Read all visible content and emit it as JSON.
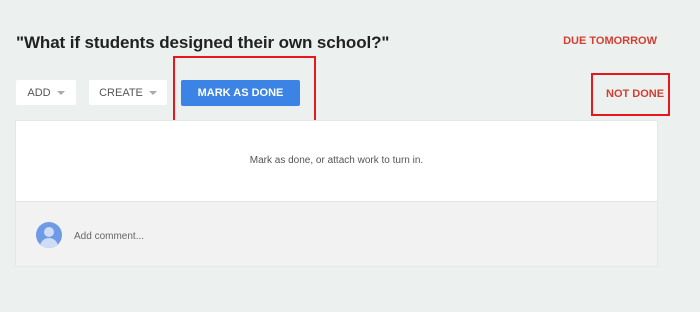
{
  "assignment": {
    "title": "\"What if students designed their own school?\"",
    "due": "DUE TOMORROW",
    "status": "NOT DONE"
  },
  "toolbar": {
    "add_label": "ADD",
    "create_label": "CREATE",
    "mark_done_label": "MARK AS DONE"
  },
  "work_area": {
    "message": "Mark as done, or attach work to turn in."
  },
  "comment": {
    "placeholder": "Add comment..."
  },
  "colors": {
    "primary": "#3b83e5",
    "status_red": "#d23f31",
    "highlight": "#e8161d"
  },
  "icons": [
    "caret-down-icon",
    "avatar-icon"
  ]
}
